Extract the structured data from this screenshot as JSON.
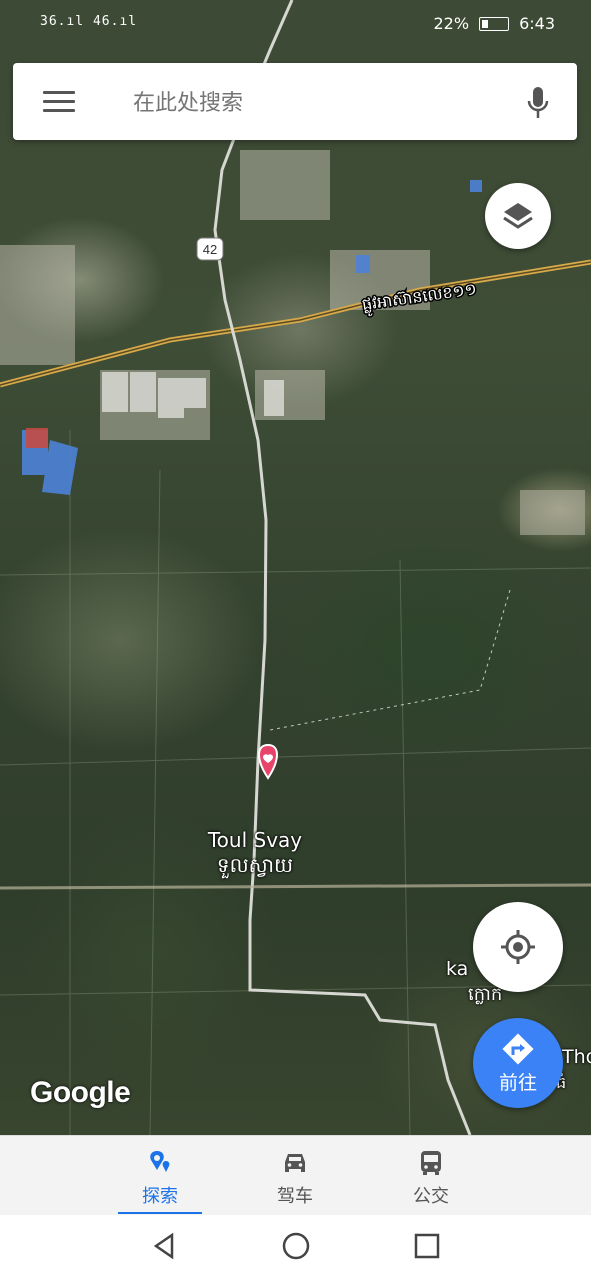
{
  "status_bar": {
    "signal_text": "36.ıl 46.ıl",
    "battery_percent": "22%",
    "time": "6:43"
  },
  "search": {
    "placeholder": "在此处搜索"
  },
  "map": {
    "road_shield": "42",
    "road_label": "ផ្លូវអាស៊ាន​លេខ១១",
    "place_name_en": "Toul Svay",
    "place_name_km": "ទួលស្វាយ",
    "place2_partial_en": "ka",
    "place2_partial_km": "ក្លោក",
    "place3_partial": "Tho",
    "place3_partial_km": "ធំ",
    "logo_text": "Google"
  },
  "actions": {
    "go_label": "前往"
  },
  "tabs": [
    {
      "label": "探索",
      "icon": "explore-pin-icon",
      "active": true
    },
    {
      "label": "驾车",
      "icon": "car-icon",
      "active": false
    },
    {
      "label": "公交",
      "icon": "bus-icon",
      "active": false
    }
  ],
  "colors": {
    "accent": "#1a73e8",
    "go_button": "#3b82f6",
    "pin": "#e8436b"
  }
}
